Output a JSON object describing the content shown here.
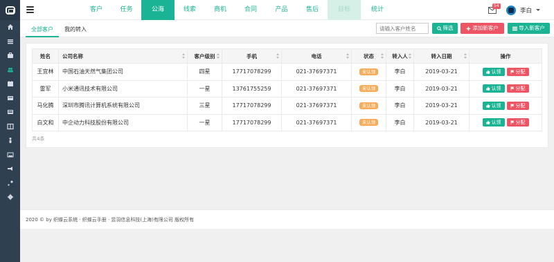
{
  "sidebar": {
    "icons": [
      "home-icon",
      "list-icon",
      "briefcase-icon",
      "users-icon",
      "calendar-icon",
      "newspaper-icon",
      "book-icon",
      "columns-icon",
      "person-icon",
      "image-icon",
      "bullhorn-icon",
      "wrench-icon",
      "gear-icon"
    ],
    "active_index": 3
  },
  "topbar": {
    "nav": [
      "客户",
      "任务",
      "公海",
      "线索",
      "商机",
      "合同",
      "产品",
      "售后",
      "目标",
      "统计"
    ],
    "active": "公海",
    "dim": "目标",
    "mail_count": "54",
    "user": "李白"
  },
  "subbar": {
    "tabs": [
      "全部客户",
      "我的转入"
    ],
    "active_tab": "全部客户",
    "search_placeholder": "请输入客户姓名",
    "filter_label": "筛选",
    "add_label": "添加新客户",
    "import_label": "导入新客户"
  },
  "table": {
    "headers": [
      "姓名",
      "公司名称",
      "客户级别",
      "手机",
      "电话",
      "状态",
      "转入人",
      "转入日期",
      "操作"
    ],
    "rows": [
      {
        "name": "王宜林",
        "company": "中国石油天然气集团公司",
        "level": "四星",
        "mobile": "17717078299",
        "phone": "021-37697371",
        "status": "未认领",
        "transfer_by": "李白",
        "date": "2019-03-21"
      },
      {
        "name": "雷军",
        "company": "小米通讯技术有限公司",
        "level": "一星",
        "mobile": "13761755259",
        "phone": "021-37697371",
        "status": "未认领",
        "transfer_by": "李白",
        "date": "2019-03-21"
      },
      {
        "name": "马化腾",
        "company": "深圳市腾讯计算机系统有限公司",
        "level": "三星",
        "mobile": "17717078299",
        "phone": "021-37697371",
        "status": "未认领",
        "transfer_by": "李白",
        "date": "2019-03-21"
      },
      {
        "name": "白文和",
        "company": "中企动力科技股份有限公司",
        "level": "一星",
        "mobile": "17717078299",
        "phone": "021-37697371",
        "status": "未认领",
        "transfer_by": "李白",
        "date": "2019-03-21"
      }
    ],
    "claim_label": "认领",
    "assign_label": "分配",
    "total": "共4条"
  },
  "footer": {
    "text": "2020 © by 织蝶云系统 · 织蝶云手册 · 昱羽信息科技(上海)有限公司 版权所有"
  },
  "colors": {
    "sidebar": "#2f4050",
    "accent": "#1ab394",
    "danger": "#ed5565",
    "warning": "#f8ac59"
  }
}
